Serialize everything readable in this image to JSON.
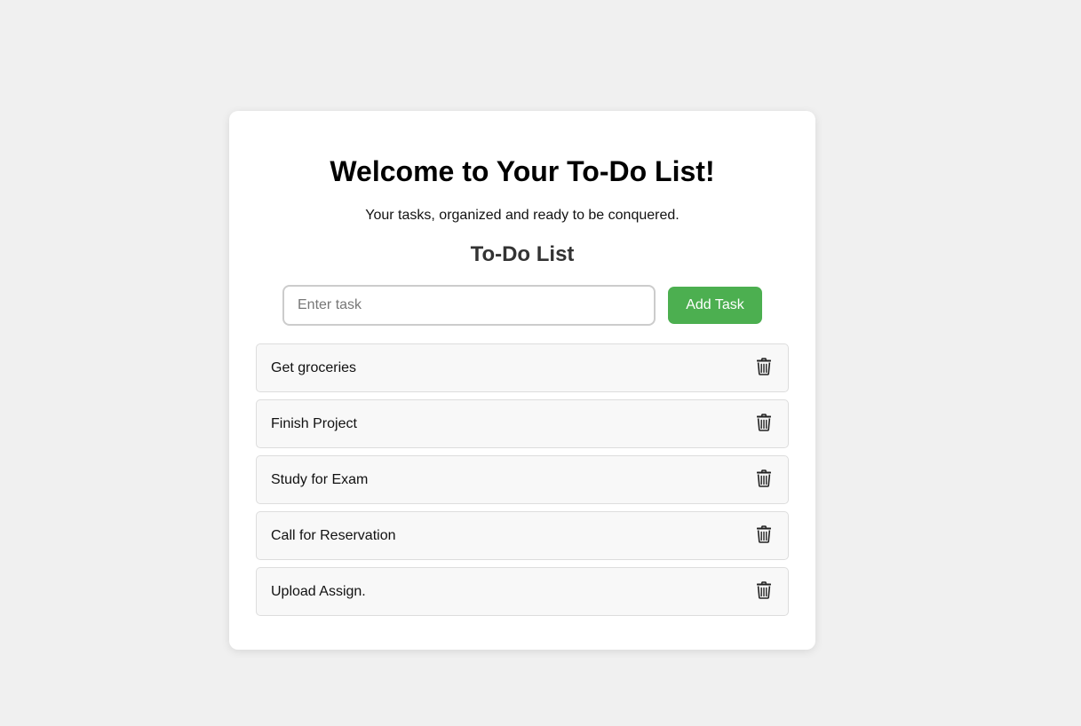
{
  "header": {
    "title": "Welcome to Your To-Do List!",
    "subtitle": "Your tasks, organized and ready to be conquered."
  },
  "todo": {
    "heading": "To-Do List",
    "input_placeholder": "Enter task",
    "add_label": "Add Task",
    "delete_icon": "trash-icon",
    "tasks": [
      "Get groceries",
      "Finish Project",
      "Study for Exam",
      "Call for Reservation",
      "Upload Assign."
    ]
  },
  "colors": {
    "page_background": "#f0f0f0",
    "card_background": "#ffffff",
    "accent_button": "#4caf50",
    "task_background": "#f8f8f8"
  }
}
